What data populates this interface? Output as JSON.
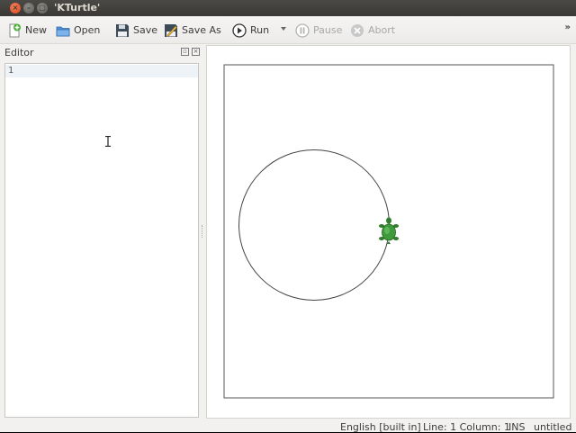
{
  "window": {
    "title": "'KTurtle'"
  },
  "toolbar": {
    "new_label": "New",
    "open_label": "Open",
    "save_label": "Save",
    "save_as_label": "Save As",
    "run_label": "Run",
    "pause_label": "Pause",
    "abort_label": "Abort",
    "more_label": "»"
  },
  "editor": {
    "title": "Editor",
    "line_number": "1"
  },
  "statusbar": {
    "language": "English [built in]",
    "position": "Line: 1 Column: 1",
    "mode": "INS",
    "filename": "untitled"
  },
  "icons": {
    "new": "new-document-icon",
    "open": "open-folder-icon",
    "save": "floppy-disk-icon",
    "save_as": "save-as-icon",
    "run": "play-icon",
    "pause": "pause-icon",
    "abort": "abort-icon",
    "turtle": "turtle-icon"
  },
  "colors": {
    "turtle": "#3f9a3b",
    "close_button": "#e9541e",
    "titlebar": "#3f3e3a"
  }
}
